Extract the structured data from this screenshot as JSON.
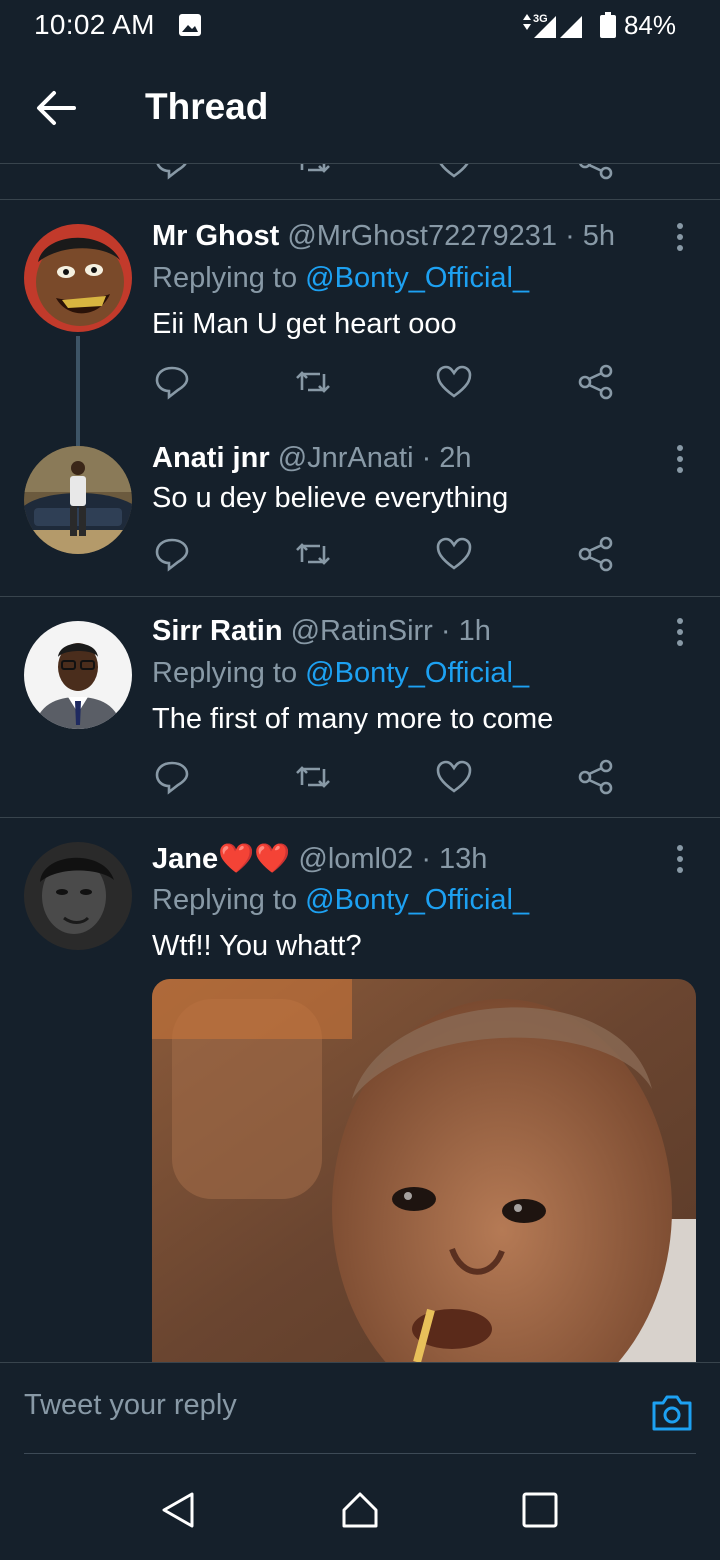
{
  "status_bar": {
    "time": "10:02 AM",
    "network": "3G",
    "battery": "84%",
    "icons": [
      "image-notification-icon",
      "data-arrows-icon",
      "signal-icon",
      "battery-icon"
    ]
  },
  "header": {
    "title": "Thread",
    "back_icon": "arrow-left-icon"
  },
  "tweets": [
    {
      "name": "Mr Ghost",
      "handle": "@MrGhost72279231",
      "time": "· 5h",
      "replying_label": "Replying to ",
      "replying_to": "@Bonty_Official_",
      "text": "Eii Man U get heart ooo"
    },
    {
      "name": "Anati jnr",
      "handle": "@JnrAnati",
      "time": "· 2h",
      "text": "So u dey believe everything"
    },
    {
      "name": "Sirr Ratin",
      "handle": "@RatinSirr",
      "time": "· 1h",
      "replying_label": "Replying to ",
      "replying_to": "@Bonty_Official_",
      "text": "The first of many more to come"
    },
    {
      "name": "Jane❤️❤️",
      "handle": "@loml02",
      "time": "· 13h",
      "replying_label": "Replying to ",
      "replying_to": "@Bonty_Official_",
      "text": "Wtf!! You whatt?"
    }
  ],
  "reply_bar": {
    "placeholder": "Tweet your reply",
    "camera_icon": "camera-icon"
  },
  "navigation": {
    "icons": [
      "back-triangle-icon",
      "home-icon",
      "recents-square-icon"
    ]
  },
  "colors": {
    "background": "#15202b",
    "accent": "#1da1f2",
    "secondary_text": "#8899a6",
    "divider": "#38444d",
    "heart": "#e0245e"
  }
}
